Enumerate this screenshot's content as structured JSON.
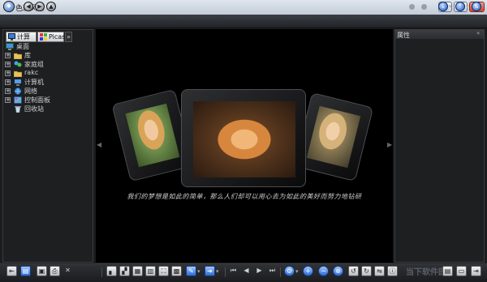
{
  "window": {
    "title": "色彩风暴",
    "minimize_label": "–",
    "maximize_label": "□",
    "close_label": "✕"
  },
  "left_panel": {
    "tabs": [
      {
        "label": "计算机",
        "icon": "computer-icon"
      },
      {
        "label": "Picasa",
        "icon": "picasa-icon"
      },
      {
        "label": "»",
        "icon": "more-tabs-icon"
      }
    ],
    "tree": [
      {
        "label": "桌面",
        "icon": "desktop-icon",
        "expander": ""
      },
      {
        "label": "库",
        "icon": "library-folder-icon",
        "expander": "+"
      },
      {
        "label": "家庭组",
        "icon": "homegroup-icon",
        "expander": "+"
      },
      {
        "label": "rakc",
        "icon": "user-folder-icon",
        "expander": "+"
      },
      {
        "label": "计算机",
        "icon": "computer-icon",
        "expander": "+"
      },
      {
        "label": "网络",
        "icon": "network-icon",
        "expander": "+"
      },
      {
        "label": "控制面板",
        "icon": "control-panel-icon",
        "expander": "+"
      },
      {
        "label": "回收站",
        "icon": "recycle-bin-icon",
        "expander": ""
      }
    ]
  },
  "viewer": {
    "caption": "我们的梦想是如此的简单，那么人们却可以用心去为如此的美好而努力地钻研"
  },
  "right_panel": {
    "title": "属性",
    "collapse_label": "«"
  },
  "watermark": "当下软件园",
  "colors": {
    "viewer_bg": "#000000",
    "panel_bg": "#1e1f21",
    "accent_blue": "#2e6ad0"
  }
}
